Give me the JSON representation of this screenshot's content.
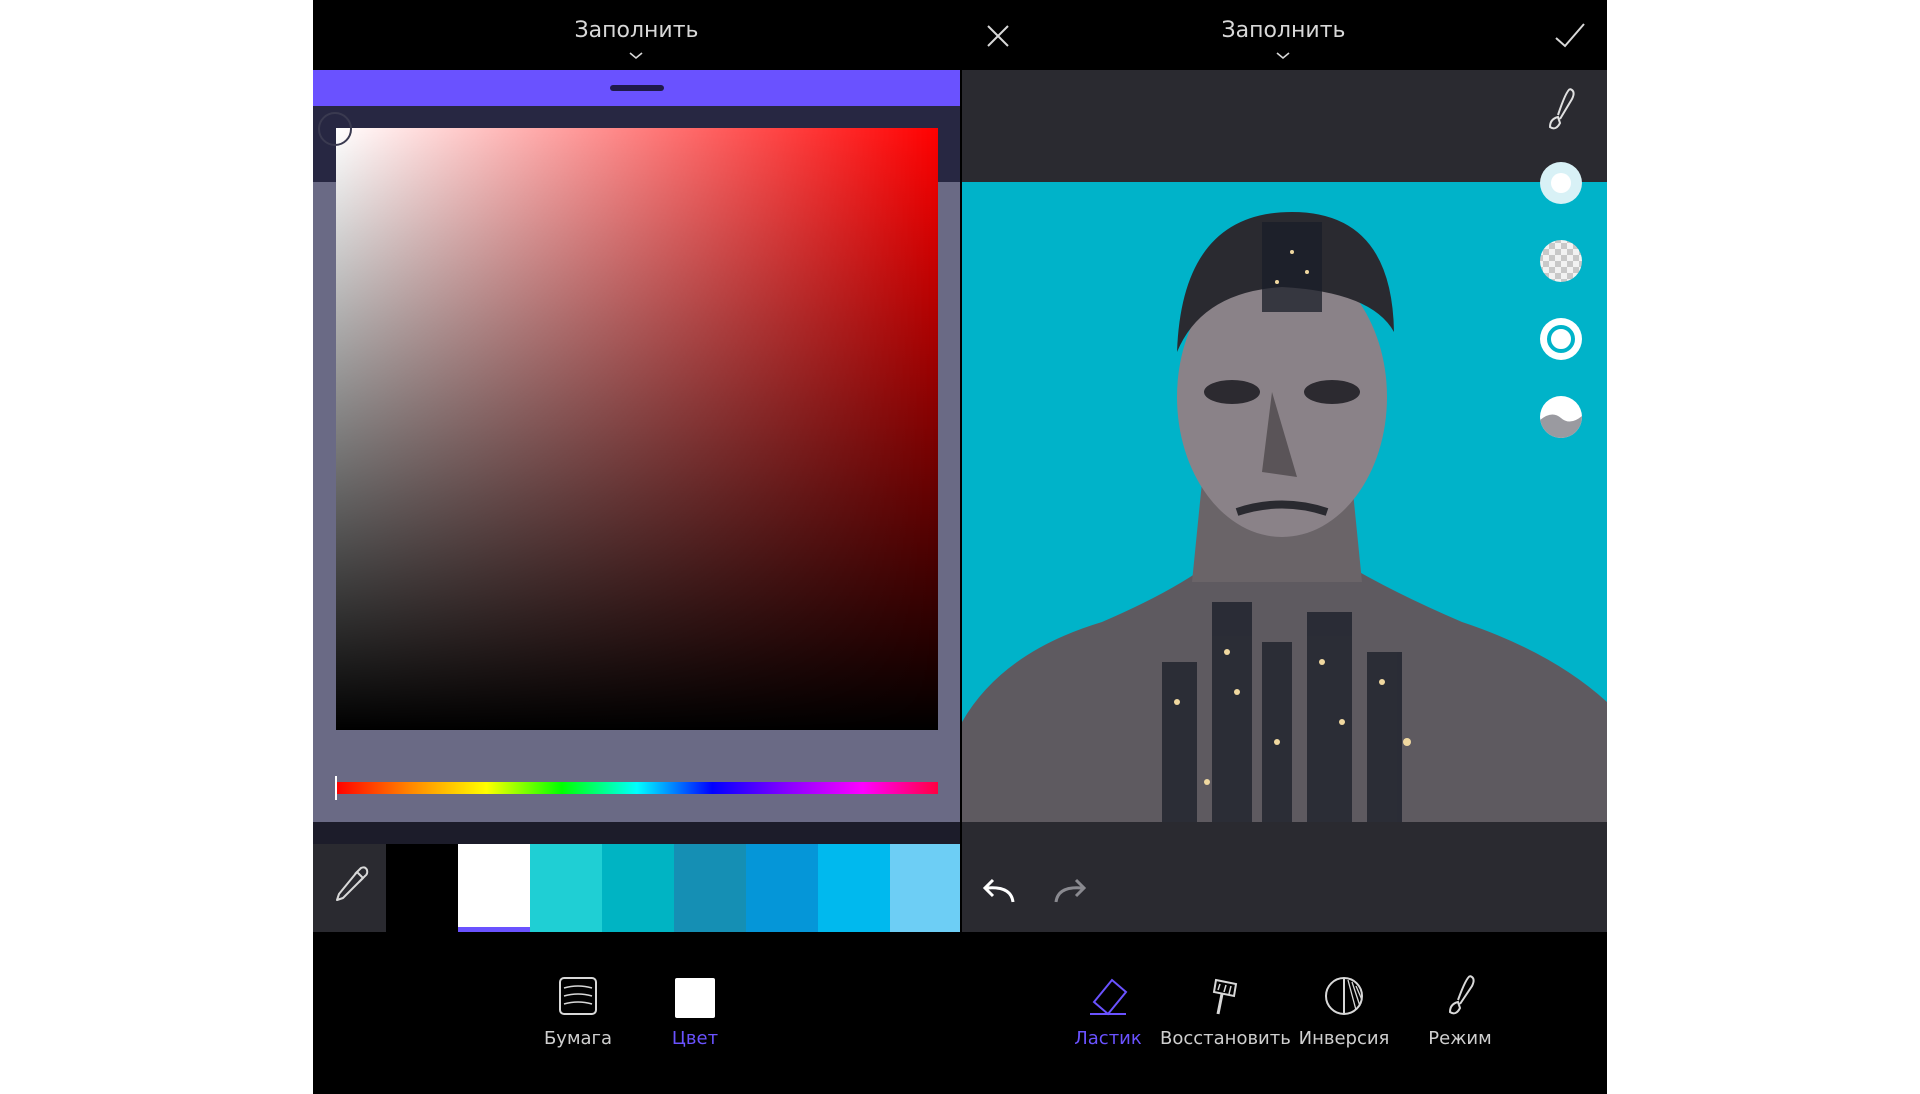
{
  "left_panel": {
    "title": "Заполнить",
    "palette": {
      "swatches": [
        {
          "color": "#000000",
          "selected": false
        },
        {
          "color": "#ffffff",
          "selected": true
        },
        {
          "color": "#1fcfd4",
          "selected": false
        },
        {
          "color": "#00b4c3",
          "selected": false
        },
        {
          "color": "#158fb4",
          "selected": false
        },
        {
          "color": "#0596d8",
          "selected": false
        },
        {
          "color": "#00b9ee",
          "selected": false
        },
        {
          "color": "#6dcef5",
          "selected": false
        }
      ]
    },
    "nav": {
      "paper_label": "Бумага",
      "color_label": "Цвет"
    }
  },
  "right_panel": {
    "title": "Заполнить",
    "nav": {
      "eraser_label": "Ластик",
      "restore_label": "Восстановить",
      "invert_label": "Инверсия",
      "mode_label": "Режим"
    }
  },
  "colors": {
    "accent": "#6a52ff",
    "picker_hue": "#ff0000",
    "canvas_background": "#00b3c9",
    "panel_background": "#000000",
    "toolbar_background": "#2a2a30"
  }
}
